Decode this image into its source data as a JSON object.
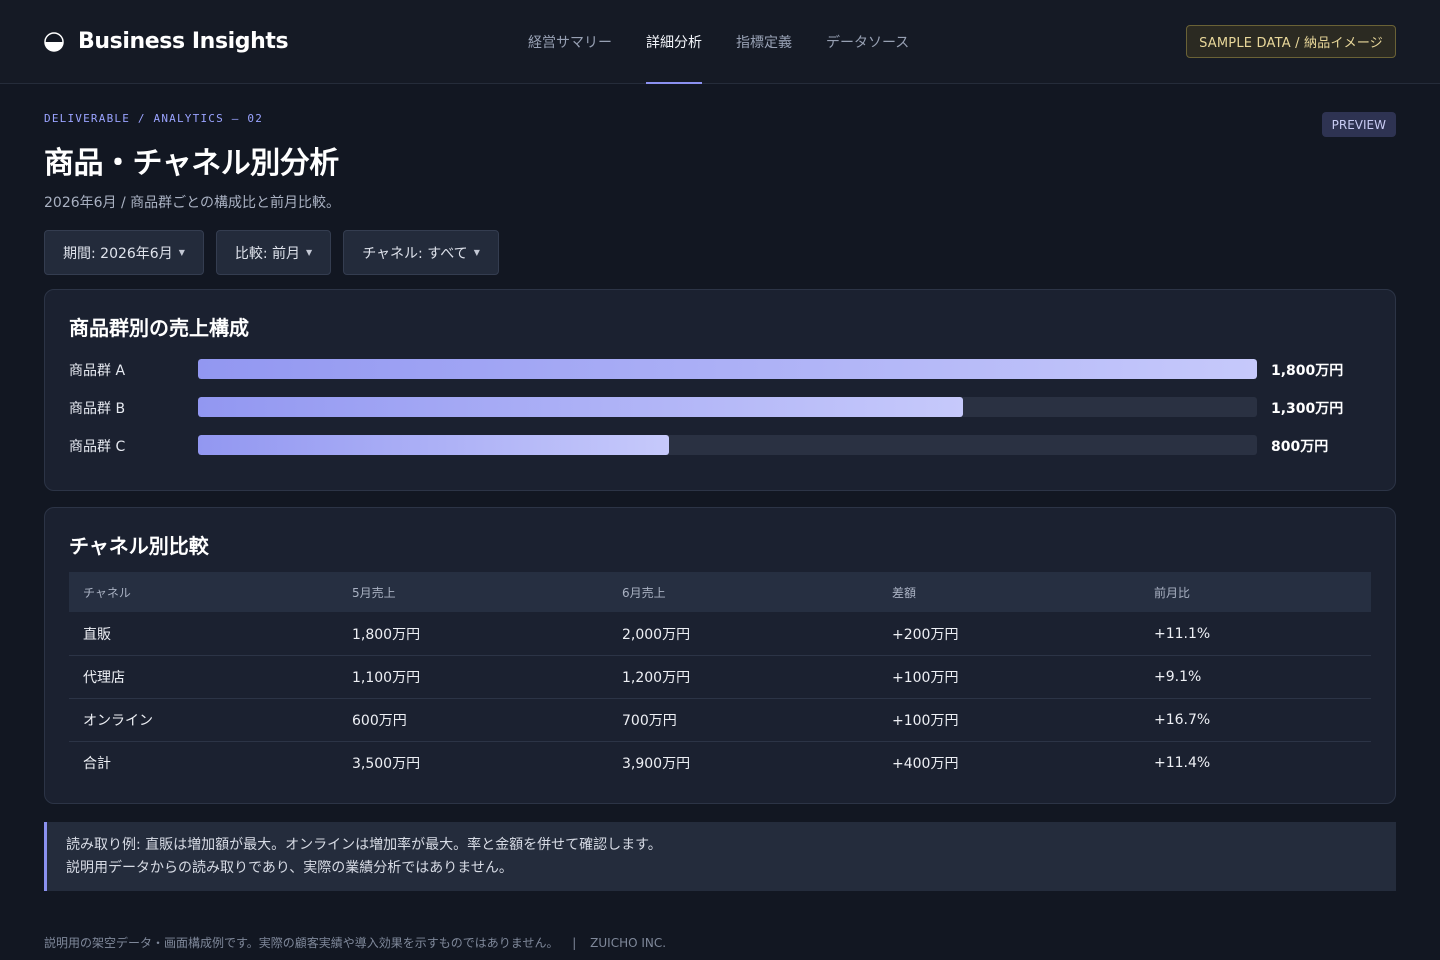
{
  "header": {
    "brand": "Business Insights",
    "nav": [
      {
        "label": "経営サマリー",
        "active": false
      },
      {
        "label": "詳細分析",
        "active": true
      },
      {
        "label": "指標定義",
        "active": false
      },
      {
        "label": "データソース",
        "active": false
      }
    ],
    "badge": "SAMPLE DATA / 納品イメージ"
  },
  "page": {
    "kicker": "DELIVERABLE / ANALYTICS — 02",
    "preview": "PREVIEW",
    "title": "商品・チャネル別分析",
    "subtitle": "2026年6月 / 商品群ごとの構成比と前月比較。"
  },
  "filters": [
    {
      "label": "期間: 2026年6月"
    },
    {
      "label": "比較: 前月"
    },
    {
      "label": "チャネル: すべて"
    }
  ],
  "product_card": {
    "title": "商品群別の売上構成",
    "max": 1800,
    "items": [
      {
        "label": "商品群 A",
        "value": 1800,
        "value_label": "1,800万円"
      },
      {
        "label": "商品群 B",
        "value": 1300,
        "value_label": "1,300万円"
      },
      {
        "label": "商品群 C",
        "value": 800,
        "value_label": "800万円"
      }
    ]
  },
  "channel_card": {
    "title": "チャネル別比較",
    "columns": [
      "チャネル",
      "5月売上",
      "6月売上",
      "差額",
      "前月比"
    ],
    "rows": [
      [
        "直販",
        "1,800万円",
        "2,000万円",
        "+200万円",
        "+11.1%"
      ],
      [
        "代理店",
        "1,100万円",
        "1,200万円",
        "+100万円",
        "+9.1%"
      ],
      [
        "オンライン",
        "600万円",
        "700万円",
        "+100万円",
        "+16.7%"
      ],
      [
        "合計",
        "3,500万円",
        "3,900万円",
        "+400万円",
        "+11.4%"
      ]
    ]
  },
  "note": {
    "line1": "読み取り例: 直販は増加額が最大。オンラインは増加率が最大。率と金額を併せて確認します。",
    "line2": "説明用データからの読み取りであり、実際の業績分析ではありません。"
  },
  "footer": {
    "disclaimer": "説明用の架空データ・画面構成例です。実際の顧客実績や導入効果を示すものではありません。",
    "separator": "|",
    "company": "ZUICHO INC."
  },
  "colors": {
    "accent": "#8b91f0",
    "background": "#121722",
    "card": "#1b2130"
  }
}
